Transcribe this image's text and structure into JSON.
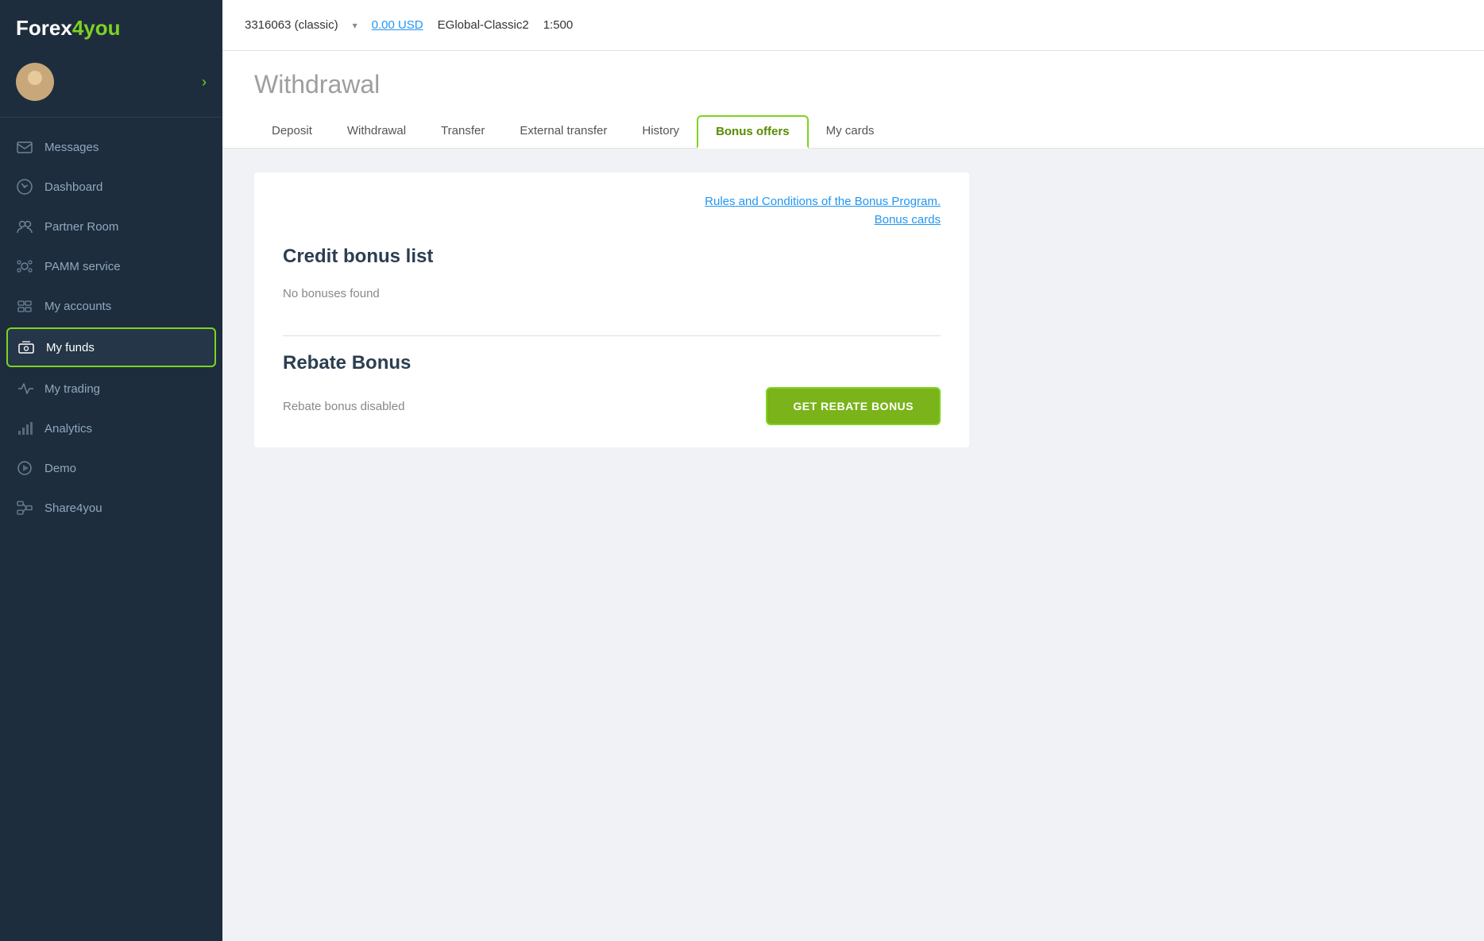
{
  "logo": {
    "forex": "Forex",
    "4you": "4you"
  },
  "topbar": {
    "account_id": "3316063",
    "account_type": "(classic)",
    "balance": "0.00 USD",
    "server": "EGlobal-Classic2",
    "leverage": "1:500"
  },
  "sidebar": {
    "nav_items": [
      {
        "id": "messages",
        "label": "Messages",
        "icon": "envelope"
      },
      {
        "id": "dashboard",
        "label": "Dashboard",
        "icon": "dashboard"
      },
      {
        "id": "partner-room",
        "label": "Partner Room",
        "icon": "partner"
      },
      {
        "id": "pamm-service",
        "label": "PAMM service",
        "icon": "pamm"
      },
      {
        "id": "my-accounts",
        "label": "My accounts",
        "icon": "accounts"
      },
      {
        "id": "my-funds",
        "label": "My funds",
        "icon": "funds",
        "active": true
      },
      {
        "id": "my-trading",
        "label": "My trading",
        "icon": "trading"
      },
      {
        "id": "analytics",
        "label": "Analytics",
        "icon": "analytics"
      },
      {
        "id": "demo",
        "label": "Demo",
        "icon": "demo"
      },
      {
        "id": "share4you",
        "label": "Share4you",
        "icon": "share4you"
      }
    ],
    "chevron": "›"
  },
  "page": {
    "title": "Withdrawal",
    "tabs": [
      {
        "id": "deposit",
        "label": "Deposit"
      },
      {
        "id": "withdrawal",
        "label": "Withdrawal"
      },
      {
        "id": "transfer",
        "label": "Transfer"
      },
      {
        "id": "external-transfer",
        "label": "External transfer"
      },
      {
        "id": "history",
        "label": "History"
      },
      {
        "id": "bonus-offers",
        "label": "Bonus offers",
        "active": true
      },
      {
        "id": "my-cards",
        "label": "My cards"
      }
    ]
  },
  "bonus_section": {
    "rules_link": "Rules and Conditions of the Bonus Program.",
    "bonus_cards_link": "Bonus cards",
    "credit_bonus_title": "Credit bonus list",
    "no_bonuses": "No bonuses found",
    "rebate_title": "Rebate Bonus",
    "rebate_disabled": "Rebate bonus disabled",
    "get_rebate_btn": "GET REBATE BONUS"
  }
}
